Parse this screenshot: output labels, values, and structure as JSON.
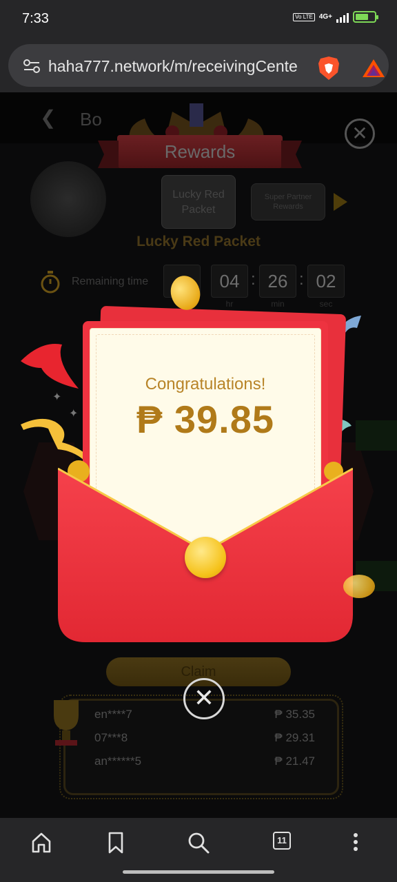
{
  "status_bar": {
    "time": "7:33",
    "network": "4G+",
    "volte": "Vo LTE"
  },
  "browser": {
    "url": "haha777.network/m/receivingCente",
    "tab_count": "11"
  },
  "page": {
    "header_title": "Bo",
    "rewards_banner": "Rewards",
    "tabs": [
      {
        "label": "Lucky Red Packet"
      },
      {
        "label": "Super Partner Rewards"
      }
    ],
    "section_title": "Lucky Red Packet",
    "timer": {
      "label": "Remaining time",
      "hours": "04",
      "minutes": "26",
      "seconds": "02",
      "unit_hr": "hr",
      "unit_min": "min",
      "unit_sec": "sec"
    },
    "claim_label": "Claim",
    "winners": [
      {
        "name": "en****7",
        "amount": "₱ 35.35"
      },
      {
        "name": "07***8",
        "amount": "₱ 29.31"
      },
      {
        "name": "an******5",
        "amount": "₱ 21.47"
      }
    ]
  },
  "reward_popup": {
    "congrats": "Congratulations!",
    "amount": "₱ 39.85"
  },
  "colors": {
    "accent_gold": "#b07a19",
    "envelope_red": "#ee3340",
    "paper": "#fffbe9"
  }
}
